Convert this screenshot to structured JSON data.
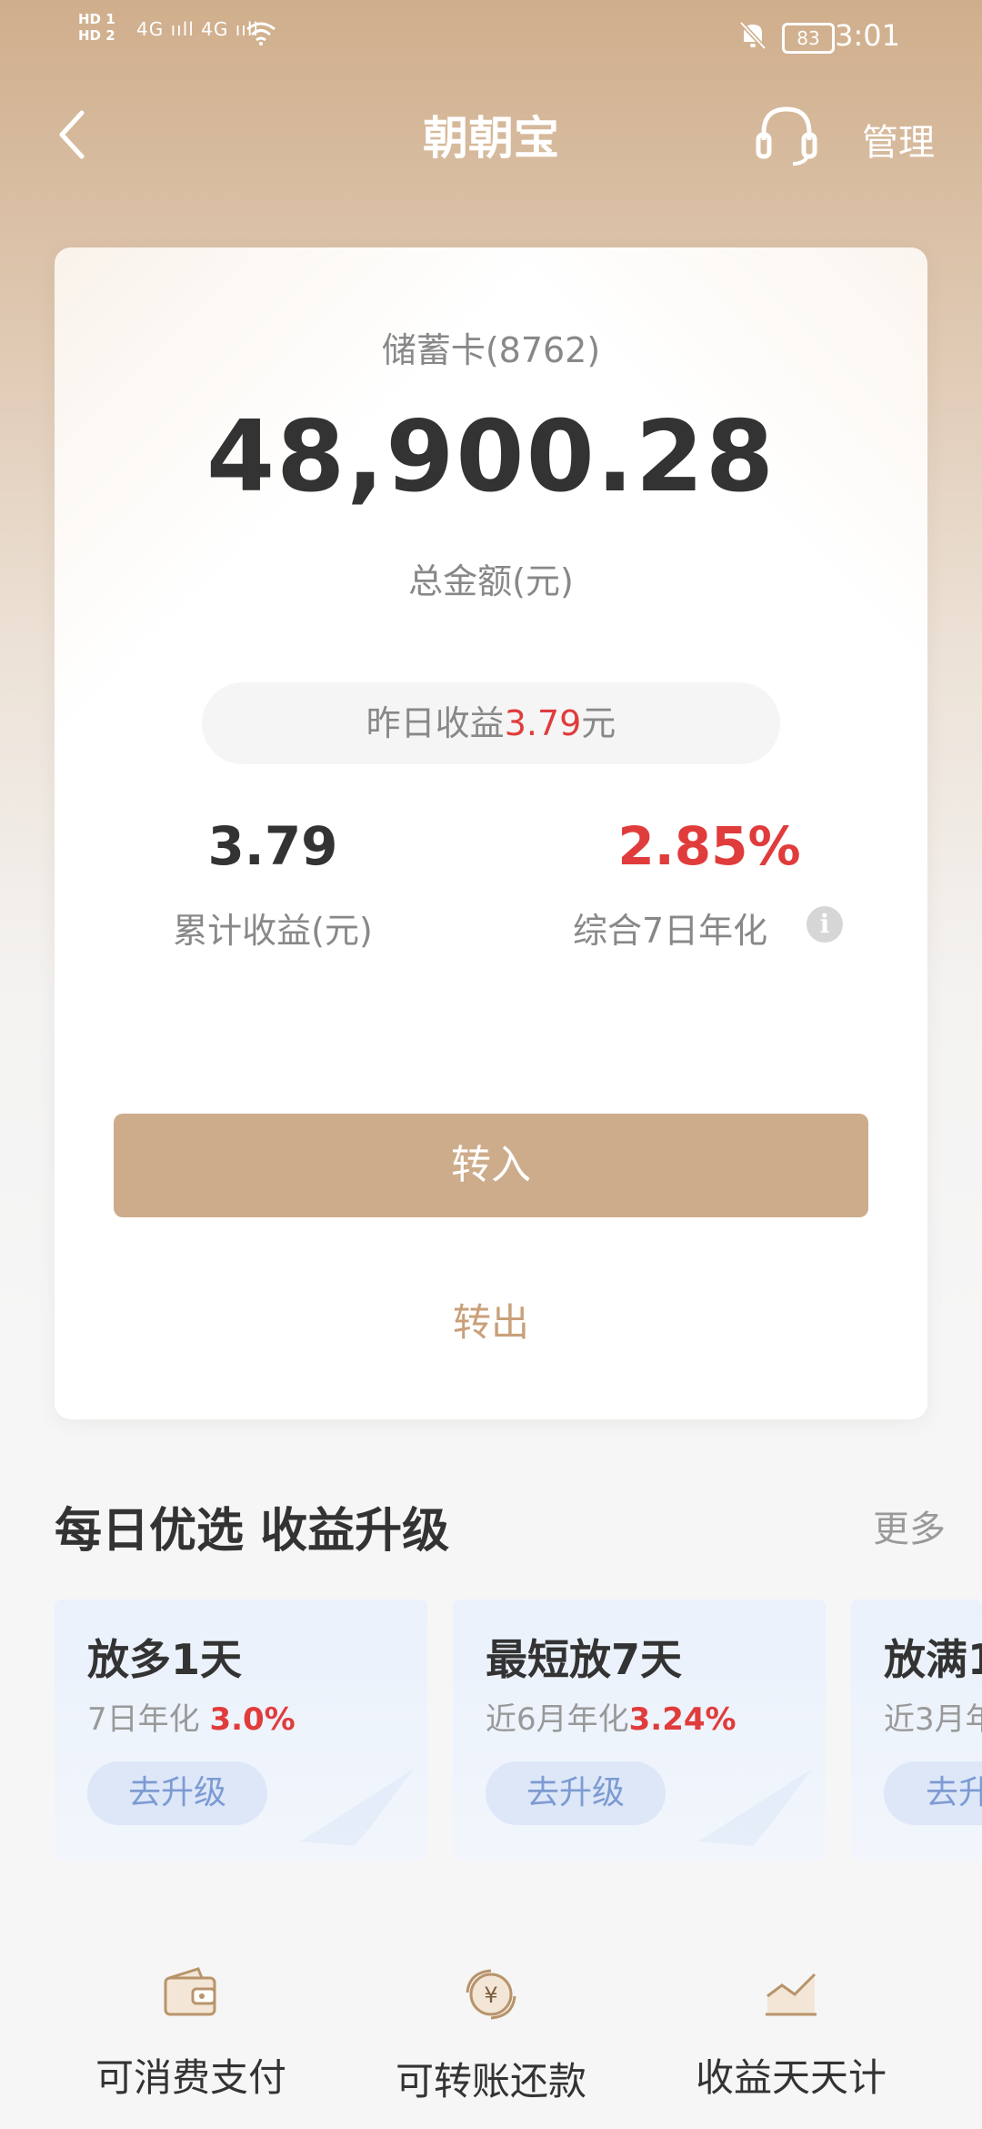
{
  "status_bar": {
    "sim_labels": "HD 1\nHD 2",
    "signal": "4G ııll 4G ııll",
    "battery": "83",
    "time": "3:01"
  },
  "nav": {
    "title": "朝朝宝",
    "manage": "管理"
  },
  "account": {
    "card_label": "储蓄卡(8762)",
    "amount": "48,900.28",
    "amount_label": "总金额(元)",
    "yesterday_prefix": "昨日收益",
    "yesterday_value": "3.79",
    "yesterday_suffix": "元",
    "cumulative_value": "3.79",
    "cumulative_label": "累计收益(元)",
    "annual_value": "2.85%",
    "annual_label": "综合7日年化",
    "transfer_in": "转入",
    "transfer_out": "转出"
  },
  "section": {
    "title": "每日优选 收益升级",
    "more": "更多"
  },
  "products": [
    {
      "title": "放多1天",
      "sub": "7日年化 ",
      "rate": "3.0%",
      "button": "去升级"
    },
    {
      "title": "最短放7天",
      "sub": "近6月年化",
      "rate": "3.24%",
      "button": "去升级"
    },
    {
      "title": "放满1",
      "sub": "近3月年",
      "rate": "",
      "button": "去升"
    }
  ],
  "features": [
    {
      "label": "可消费支付",
      "icon": "wallet-icon"
    },
    {
      "label": "可转账还款",
      "icon": "yuan-refresh-icon"
    },
    {
      "label": "收益天天计",
      "icon": "trend-chart-icon"
    }
  ],
  "colors": {
    "accent": "#cdac8b",
    "red": "#e03c3c",
    "blue_button": "#7d9bd3"
  }
}
